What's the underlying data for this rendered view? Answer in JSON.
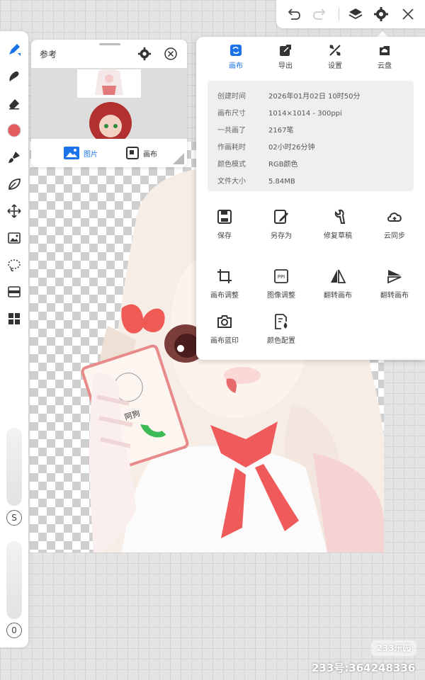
{
  "colors": {
    "accent": "#1a73e8",
    "current_brush_color": "#e55a5a",
    "canvas_bg": "#e4e4e4"
  },
  "left_toolbar": {
    "tools": [
      {
        "name": "brush-pen-icon",
        "active": true
      },
      {
        "name": "smudge-icon"
      },
      {
        "name": "eraser-icon"
      },
      {
        "name": "color-swatch"
      },
      {
        "name": "paintbrush-icon"
      },
      {
        "name": "leaf-icon"
      },
      {
        "name": "move-icon"
      },
      {
        "name": "image-adjust-icon"
      },
      {
        "name": "lasso-select-icon"
      },
      {
        "name": "filter-icon"
      },
      {
        "name": "grid-layout-icon"
      }
    ],
    "size_label": "S",
    "opacity_label": "0"
  },
  "top_toolbar": {
    "icons": [
      "undo-icon",
      "redo-icon",
      "layers-icon",
      "settings-icon",
      "close-icon"
    ]
  },
  "reference_panel": {
    "title": "参考",
    "tabs": [
      {
        "label": "图片",
        "active": true
      },
      {
        "label": "画布",
        "active": false
      }
    ]
  },
  "info_panel": {
    "tabs": [
      {
        "label": "画布",
        "icon": "canvas-icon",
        "active": true
      },
      {
        "label": "导出",
        "icon": "export-icon",
        "active": false
      },
      {
        "label": "设置",
        "icon": "tools-icon",
        "active": false
      },
      {
        "label": "云盘",
        "icon": "cloud-drive-icon",
        "active": false
      }
    ],
    "info": [
      {
        "key": "创建时间",
        "value": "2026年01月02日 10时50分"
      },
      {
        "key": "画布尺寸",
        "value": "1014×1014 - 300ppi"
      },
      {
        "key": "一共画了",
        "value": "2167笔"
      },
      {
        "key": "作画耗时",
        "value": "02小时26分钟"
      },
      {
        "key": "颜色模式",
        "value": "RGB颜色"
      },
      {
        "key": "文件大小",
        "value": "5.84MB"
      }
    ],
    "actions": [
      {
        "label": "保存",
        "icon": "save-icon"
      },
      {
        "label": "另存为",
        "icon": "save-as-icon"
      },
      {
        "label": "修复草稿",
        "icon": "repair-icon"
      },
      {
        "label": "云同步",
        "icon": "cloud-sync-icon"
      },
      {
        "label": "画布调整",
        "icon": "crop-icon"
      },
      {
        "label": "图像调整",
        "icon": "ppi-icon"
      },
      {
        "label": "翻转画布",
        "icon": "flip-horizontal-icon"
      },
      {
        "label": "翻转画布",
        "icon": "flip-vertical-icon"
      },
      {
        "label": "画布蓝印",
        "icon": "camera-icon"
      },
      {
        "label": "颜色配置",
        "icon": "color-profile-icon"
      }
    ]
  },
  "artwork": {
    "phone_label": "阿狗"
  },
  "watermark": {
    "logo": "233乐园",
    "id": "233号:364248336"
  }
}
